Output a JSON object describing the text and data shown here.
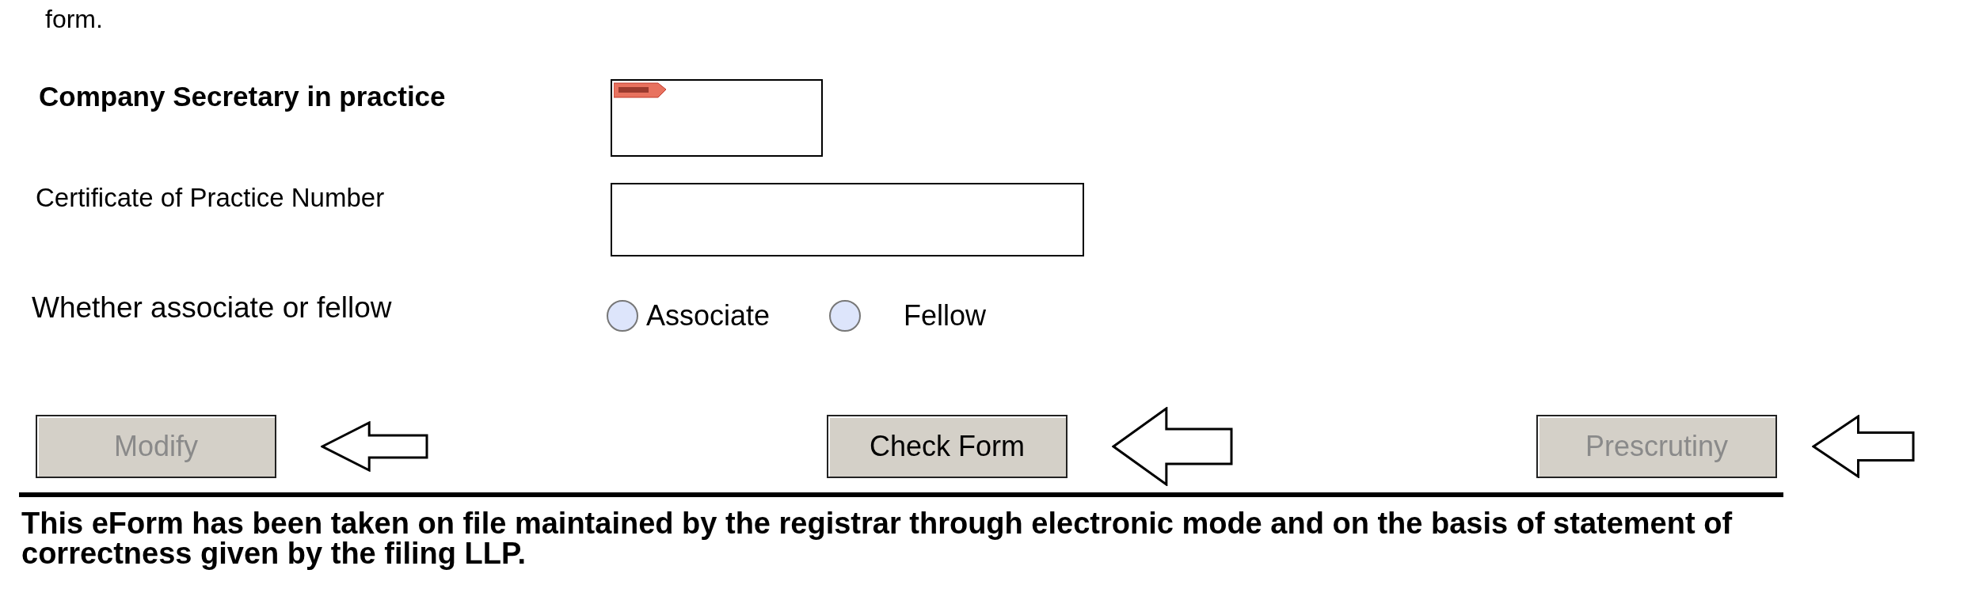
{
  "intro_tail": "form.",
  "fields": [
    {
      "kind": "flagged_box",
      "label": "Company Secretary in practice"
    },
    {
      "kind": "text_box",
      "label": "Certificate of Practice Number"
    }
  ],
  "membership": {
    "label": "Whether associate or fellow",
    "options": [
      {
        "label": "Associate",
        "selected": false
      },
      {
        "label": "Fellow",
        "selected": false
      }
    ]
  },
  "buttons": [
    {
      "label": "Modify",
      "disabled": true
    },
    {
      "label": "Check Form",
      "disabled": false
    },
    {
      "label": "Prescrutiny",
      "disabled": true
    }
  ],
  "footer_note": "This eForm has been taken on file maintained by the registrar through electronic mode and on the basis of statement of correctness given by the filing LLP."
}
